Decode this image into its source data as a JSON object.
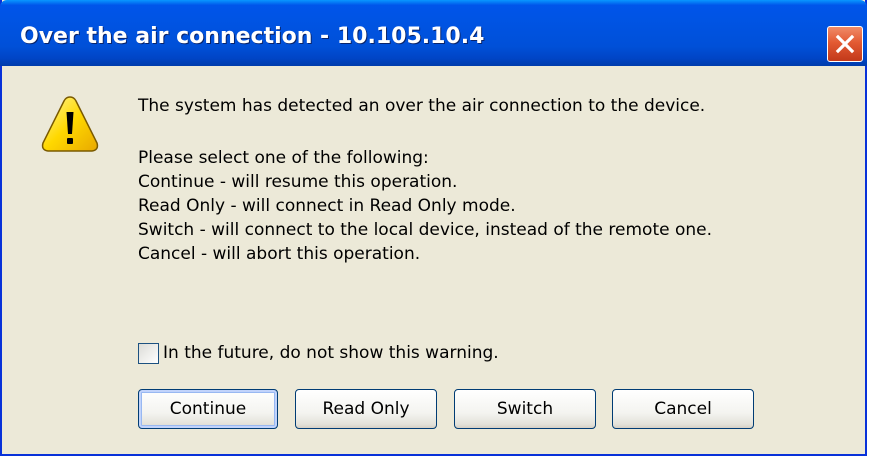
{
  "window": {
    "title": "Over the air connection - 10.105.10.4",
    "title_bar_color": "#0054e3",
    "close_button_color": "#e35a33"
  },
  "icons": {
    "warning": "warning-icon",
    "close": "close-icon"
  },
  "message": {
    "main": "The system has detected an over the air connection to the device.",
    "prompt": "Please select one of the following:",
    "options": [
      "Continue - will resume this operation.",
      "Read Only - will connect in Read Only mode.",
      "Switch - will connect to the local device, instead of the remote one.",
      "Cancel - will abort this operation."
    ]
  },
  "checkbox": {
    "label": "In the future, do not show this warning.",
    "checked": false
  },
  "buttons": {
    "continue_label": "Continue",
    "read_only_label": "Read Only",
    "switch_label": "Switch",
    "cancel_label": "Cancel"
  }
}
